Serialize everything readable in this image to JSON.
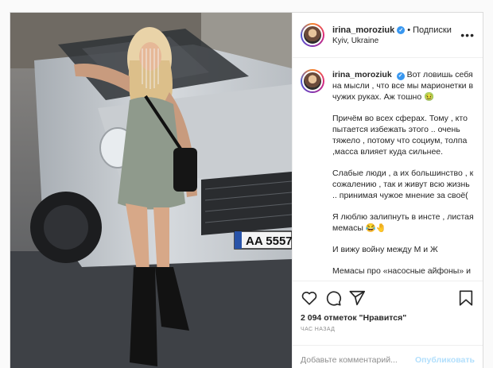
{
  "post": {
    "username": "irina_moroziuk",
    "verified_icon": "verified-badge-icon",
    "separator": "•",
    "follow_label": "Подписки",
    "location": "Kyiv, Ukraine",
    "more_icon": "more-options-icon",
    "more_label": "•••",
    "photo": {
      "plate_text": "AA 5557"
    }
  },
  "caption": {
    "username": "irina_moroziuk",
    "paragraphs": [
      "Вот ловишь себя на мысли , что все мы марионетки в чужих руках. Аж тошно 🤢",
      "Причём во всех сферах. Тому , кто пытается избежать этого .. очень тяжело , потому что социум, толпа ,масса влияет куда сильнее.",
      "Слабые люди , а их большинство , к сожалению , так и живут всю жизнь .. принимая чужое мнение за своё(",
      "Я люблю залипнуть в инсте , листая мемасы 😂🤚",
      "И вижу войну между М и Ж",
      "Мемасы про «насосные айфоны» и"
    ]
  },
  "actions": {
    "like_icon": "heart-icon",
    "comment_icon": "comment-icon",
    "share_icon": "share-icon",
    "save_icon": "bookmark-icon",
    "likes_count": "2 094",
    "likes_text": "отметок \"Нравится\"",
    "time": "час назад"
  },
  "comment": {
    "placeholder": "Добавьте комментарий...",
    "publish_label": "Опубликовать"
  },
  "colors": {
    "accent_blue": "#3897f0",
    "publish_disabled": "#b2dffc",
    "border": "#dbdbdb"
  }
}
